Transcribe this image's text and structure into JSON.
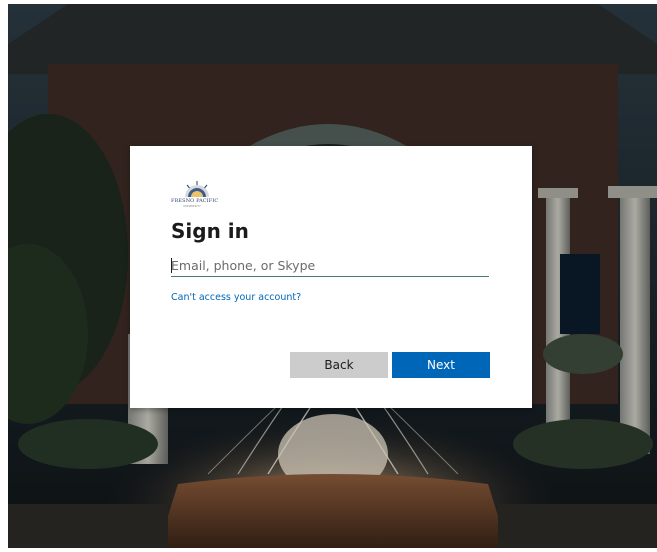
{
  "brand": {
    "logo_text": "FRESNO PACIFIC",
    "logo_subtext": "UNIVERSITY"
  },
  "signin": {
    "title": "Sign in",
    "email_placeholder": "Email, phone, or Skype",
    "email_value": "",
    "cant_access_link": "Can't access your account?",
    "back_label": "Back",
    "next_label": "Next"
  },
  "colors": {
    "primary": "#0067b8",
    "secondary_button": "#cccccc",
    "card_background": "#ffffff",
    "title_text": "#1b1b1b"
  }
}
